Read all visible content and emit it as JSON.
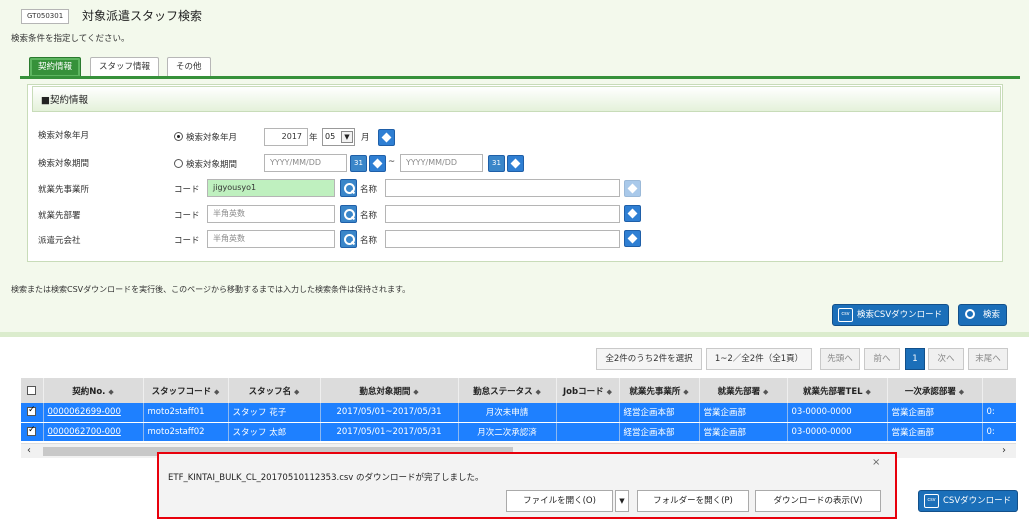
{
  "screen": {
    "id": "GT050301",
    "title": "対象派遣スタッフ検索",
    "instruction": "検索条件を指定してください。"
  },
  "tabs": [
    "契約情報",
    "スタッフ情報",
    "その他"
  ],
  "section_title": "■契約情報",
  "form": {
    "target_month_label": "検索対象年月",
    "target_period_label": "検索対象期間",
    "workplace_label": "就業先事業所",
    "department_label": "就業先部署",
    "dispatch_company_label": "派遣元会社",
    "radio_month_label": "検索対象年月",
    "radio_period_label": "検索対象期間",
    "year_value": "2017",
    "year_unit": "年",
    "month_value": "05",
    "month_unit": "月",
    "date_from_placeholder": "YYYY/MM/DD",
    "date_to_placeholder": "YYYY/MM/DD",
    "tilde": "~",
    "code_label": "コード",
    "name_label": "名称",
    "workplace_code": "jigyousyo1",
    "code_placeholder": "半角英数"
  },
  "note": "検索または検索CSVダウンロードを実行後、このページから移動するまでは入力した検索条件は保持されます。",
  "buttons": {
    "search_csv": "検索CSVダウンロード",
    "search": "検索",
    "csv": "CSVダウンロード",
    "csv_icon": "csv"
  },
  "pager": {
    "selection": "全2件のうち2件を選択",
    "range": "1~2／全2件（全1頁）",
    "first": "先頭へ",
    "prev": "前へ",
    "current": "1",
    "next": "次へ",
    "last": "末尾へ"
  },
  "table": {
    "columns": [
      "契約No.",
      "スタッフコード",
      "スタッフ名",
      "勤怠対象期間",
      "勤怠ステータス",
      "Jobコード",
      "就業先事業所",
      "就業先部署",
      "就業先部署TEL",
      "一次承認部署",
      ""
    ],
    "rows": [
      [
        "0000062699-000",
        "moto2staff01",
        "スタッフ 花子",
        "2017/05/01~2017/05/31",
        "月次未申請",
        "",
        "経営企画本部",
        "営業企画部",
        "03-0000-0000",
        "営業企画部",
        "0:"
      ],
      [
        "0000062700-000",
        "moto2staff02",
        "スタッフ 太郎",
        "2017/05/01~2017/05/31",
        "月次二次承認済",
        "",
        "経営企画本部",
        "営業企画部",
        "03-0000-0000",
        "営業企画部",
        "0:"
      ]
    ]
  },
  "download_bar": {
    "message": "ETF_KINTAI_BULK_CL_20170510112353.csv のダウンロードが完了しました。",
    "open_file": "ファイルを開く(O)",
    "open_folder": "フォルダーを開く(P)",
    "view_downloads": "ダウンロードの表示(V)",
    "close": "×"
  }
}
